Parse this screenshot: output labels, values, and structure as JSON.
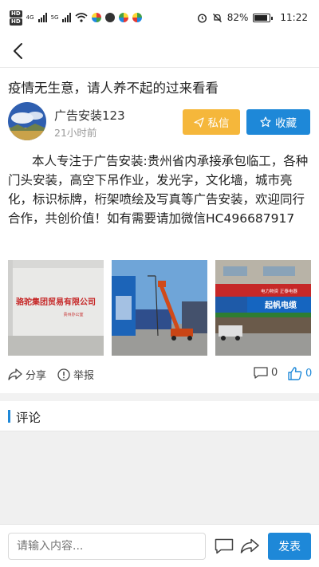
{
  "status_bar": {
    "battery_pct": "82%",
    "time": "11:22",
    "hd1": "HD",
    "hd2": "HD",
    "net1": "4G",
    "net2": "5G"
  },
  "post": {
    "title": "疫情无生意，请人养不起的过来看看",
    "author": "广告安装123",
    "time": "21小时前",
    "body": "本人专注于广告安装:贵州省内承接承包临工，各种门头安装，高空下吊作业，发光字，文化墙，城市亮化，标识标牌，桁架喷绘及写真等广告安装，欢迎同行合作，共创价值！如有需要请加微信HC496687917",
    "message_label": "私信",
    "favorite_label": "收藏"
  },
  "photos": [
    {
      "sign_text": "骆驼集团贸易有限公司",
      "sub_text": "贵州办公室"
    },
    {
      "sign_text": "",
      "sub_text": ""
    },
    {
      "sign_text": "起帆电缆",
      "sub_text": "电力物资 正泰电器"
    }
  ],
  "actions": {
    "share_label": "分享",
    "report_label": "举报",
    "comment_count": "0",
    "like_count": "0"
  },
  "comments": {
    "section_title": "评论"
  },
  "composer": {
    "placeholder": "请输入内容...",
    "send_label": "发表"
  },
  "colors": {
    "accent_blue": "#1e88d8",
    "message_orange": "#f5b73b"
  }
}
